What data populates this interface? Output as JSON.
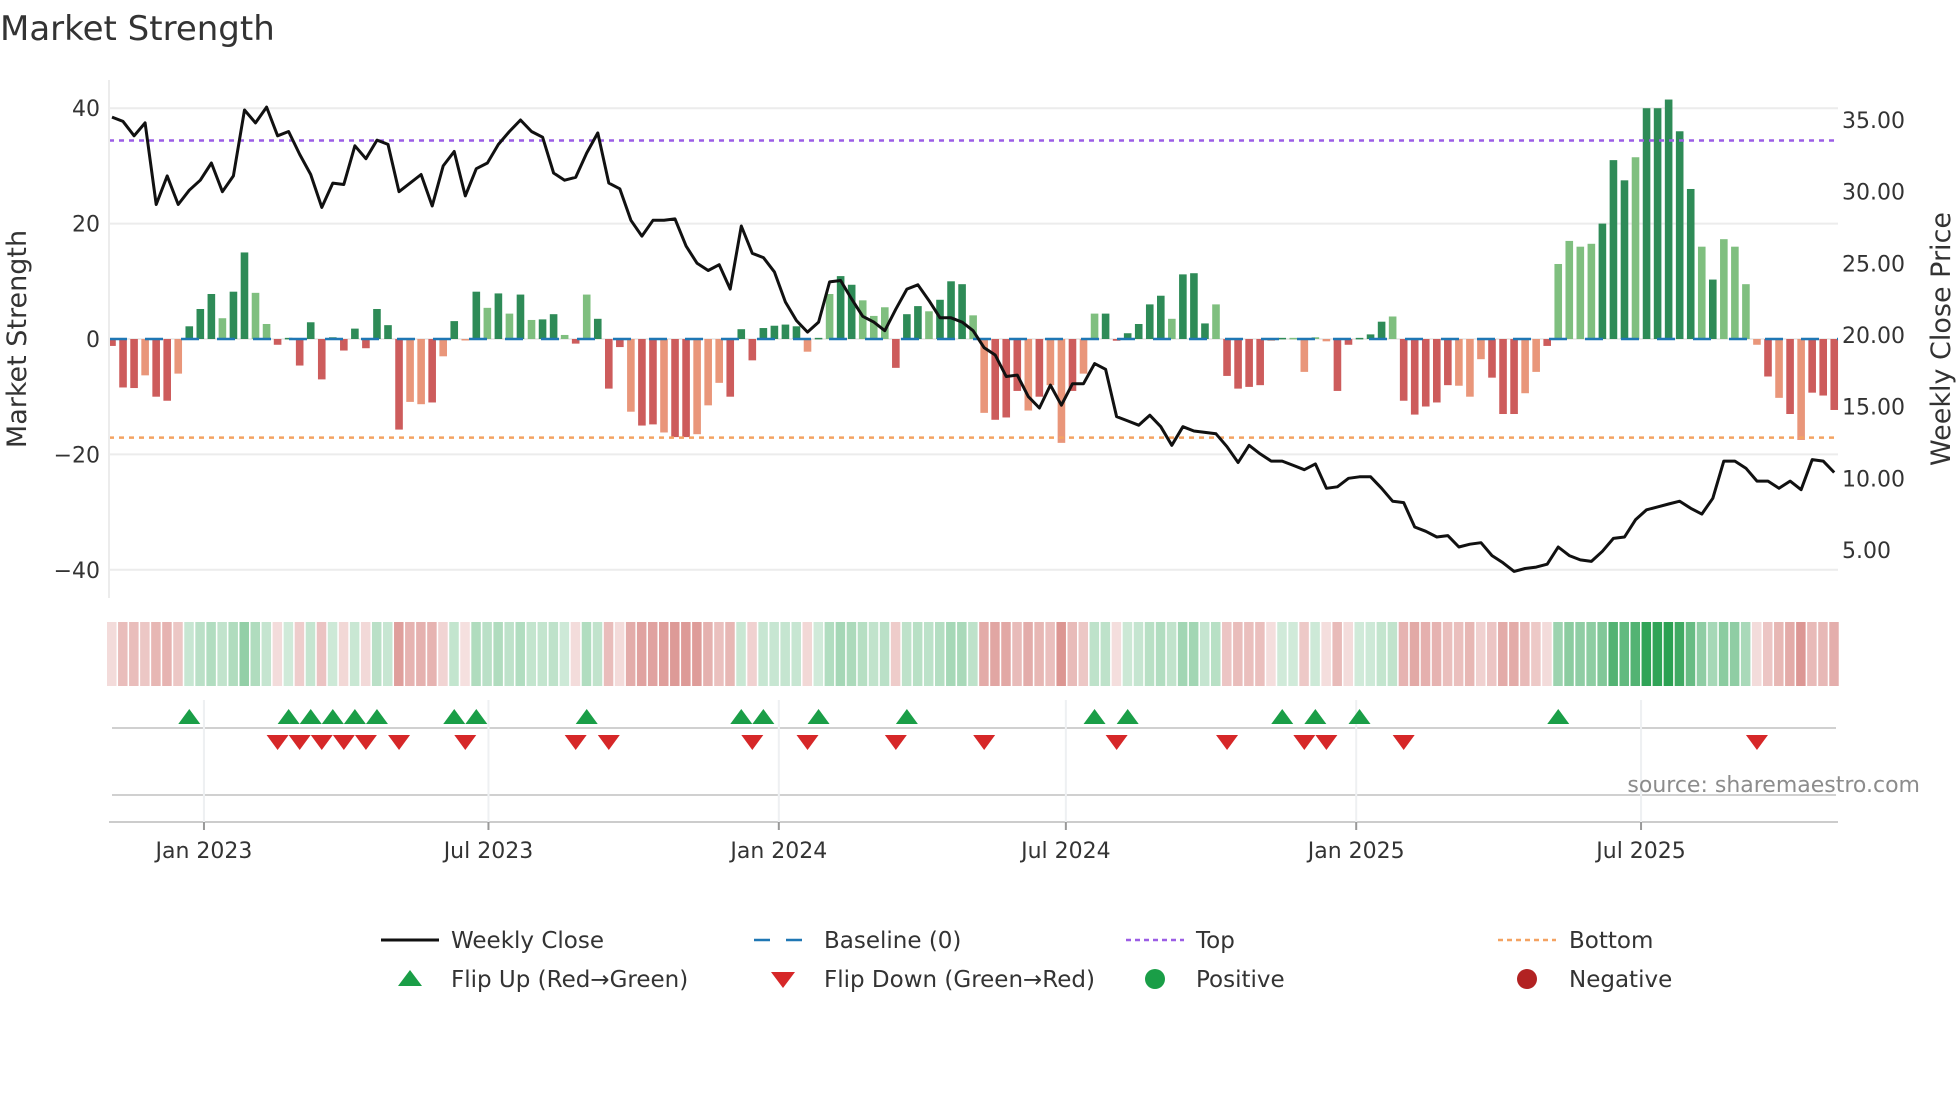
{
  "chart_data": {
    "type": "bar",
    "title": "Market Strength",
    "ylabel": "Market Strength",
    "y2label": "Weekly Close Price",
    "ylim": [
      -46,
      45
    ],
    "y2lim": [
      2.5,
      38.4
    ],
    "y_ticks": [
      "40",
      "20",
      "0",
      "−20",
      "−40"
    ],
    "y_tick_values": [
      40,
      20,
      0,
      -20,
      -40
    ],
    "y2_ticks": [
      "35.00",
      "30.00",
      "25.00",
      "20.00",
      "15.00",
      "10.00",
      "5.00"
    ],
    "y2_tick_values": [
      35,
      30,
      25,
      20,
      15,
      10,
      5
    ],
    "x_ticks": [
      {
        "label": "Jan 2023",
        "week": 9.33
      },
      {
        "label": "Jul 2023",
        "week": 35.1
      },
      {
        "label": "Jan 2024",
        "week": 61.4
      },
      {
        "label": "Jul 2024",
        "week": 87.4
      },
      {
        "label": "Jan 2025",
        "week": 113.7
      },
      {
        "label": "Jul 2025",
        "week": 139.5
      }
    ],
    "top_level": 34.4,
    "bottom_level": -17.1,
    "baseline": 0,
    "strength": [
      -1.2,
      -8.4,
      -8.5,
      -6.3,
      -10,
      -10.7,
      -6,
      2.2,
      5.2,
      7.8,
      3.6,
      8.2,
      15,
      8,
      2.6,
      -1,
      0.2,
      -4.6,
      2.9,
      -7,
      0.3,
      -2,
      1.8,
      -1.6,
      5.2,
      2.4,
      -15.7,
      -10.9,
      -11.3,
      -11,
      -3,
      3.1,
      -0.2,
      8.2,
      5.4,
      7.9,
      4.4,
      7.7,
      3.3,
      3.4,
      4.3,
      0.7,
      -0.8,
      7.7,
      3.5,
      -8.6,
      -1.4,
      -12.6,
      -15,
      -14.8,
      -16.2,
      -17,
      -17,
      -16.5,
      -11.5,
      -7.6,
      -10,
      1.7,
      -3.7,
      1.9,
      2.3,
      2.5,
      2.2,
      -2.2,
      0.2,
      7.8,
      10.9,
      9.4,
      6.7,
      4,
      5.5,
      -5,
      4.3,
      5.7,
      4.8,
      6.8,
      10,
      9.5,
      4.1,
      -12.8,
      -14,
      -13.6,
      -9,
      -12.4,
      -10,
      -8,
      -18,
      -9,
      -6,
      4.4,
      4.4,
      -0.3,
      1,
      2.6,
      6,
      7.5,
      3.5,
      11.2,
      11.4,
      2.7,
      6,
      -6.4,
      -8.6,
      -8.3,
      -8,
      -0.3,
      0.2,
      0.2,
      -5.7,
      0.3,
      -0.4,
      -9,
      -1,
      0.2,
      0.8,
      3,
      3.9,
      -10.7,
      -13.1,
      -11.7,
      -11,
      -8,
      -8.1,
      -10,
      -3.5,
      -6.7,
      -13,
      -13,
      -9.4,
      -5.7,
      -1.2,
      13,
      17,
      16,
      16.5,
      20,
      31,
      27.5,
      31.5,
      40,
      40,
      41.5,
      36,
      26,
      16,
      10.3,
      17.3,
      16,
      9.5,
      -1,
      -6.5,
      -10.2,
      -13,
      -17.5,
      -9.3,
      -9.8,
      -12.3
    ],
    "shade": "dddlddldddlddllddddddddddddlldldldldldlddldldddlddlddllldddddddldlddllldddldddlldddldlldllddddddldddlddddldlllldddddldddddllldddlldlllldddldddddldlllldldldddddldd",
    "weekly_close": [
      35.2,
      34.9,
      33.9,
      34.8,
      29.1,
      31.1,
      29.1,
      30.1,
      30.8,
      32.0,
      30.0,
      31.1,
      35.7,
      34.8,
      35.9,
      33.9,
      34.2,
      32.6,
      31.2,
      28.9,
      30.6,
      30.5,
      33.2,
      32.3,
      33.6,
      33.3,
      30.0,
      30.6,
      31.2,
      29.0,
      31.8,
      32.8,
      29.7,
      31.6,
      32.0,
      33.3,
      34.2,
      35.0,
      34.2,
      33.8,
      31.3,
      30.8,
      31.0,
      32.7,
      34.1,
      30.6,
      30.2,
      28.0,
      26.9,
      28.0,
      28.0,
      28.1,
      26.2,
      25.0,
      24.5,
      24.9,
      23.2,
      27.6,
      25.7,
      25.4,
      24.4,
      22.3,
      21.0,
      20.2,
      20.9,
      23.7,
      23.8,
      22.5,
      21.3,
      20.9,
      20.3,
      21.8,
      23.2,
      23.5,
      22.4,
      21.2,
      21.2,
      20.9,
      20.3,
      19.1,
      18.6,
      17.1,
      17.2,
      15.7,
      14.9,
      16.5,
      15.1,
      16.6,
      16.6,
      18.0,
      17.6,
      14.3,
      14.0,
      13.7,
      14.4,
      13.6,
      12.3,
      13.6,
      13.3,
      13.2,
      13.1,
      12.2,
      11.1,
      12.3,
      11.7,
      11.2,
      11.2,
      10.9,
      10.6,
      11.0,
      9.3,
      9.4,
      10.0,
      10.1,
      10.1,
      9.3,
      8.4,
      8.3,
      6.6,
      6.3,
      5.9,
      6.0,
      5.2,
      5.4,
      5.5,
      4.6,
      4.1,
      3.5,
      3.7,
      3.8,
      4.0,
      5.2,
      4.6,
      4.3,
      4.2,
      4.9,
      5.8,
      5.9,
      7.1,
      7.8,
      8.0,
      8.2,
      8.4,
      7.9,
      7.5,
      8.6,
      11.2,
      11.2,
      10.7,
      9.8,
      9.8,
      9.3,
      9.8,
      9.2,
      11.3,
      11.2,
      10.4
    ],
    "flip_up_weeks": [
      8,
      17,
      19,
      21,
      23,
      25,
      32,
      34,
      44,
      58,
      60,
      65,
      73,
      90,
      93,
      107,
      110,
      114,
      132
    ],
    "flip_down_weeks": [
      16,
      18,
      20,
      22,
      24,
      27,
      33,
      43,
      46,
      59,
      64,
      72,
      80,
      92,
      102,
      109,
      111,
      118,
      150
    ],
    "legend": {
      "position": "bottom",
      "items": [
        {
          "label": "Weekly Close",
          "kind": "line",
          "color": "#111111"
        },
        {
          "label": "Baseline (0)",
          "kind": "dash",
          "color": "#1f77b4"
        },
        {
          "label": "Top",
          "kind": "dot",
          "color": "#9b5de5"
        },
        {
          "label": "Bottom",
          "kind": "dot",
          "color": "#f4a261"
        },
        {
          "label": "Flip Up (Red→Green)",
          "kind": "up",
          "color": "#1a9e47"
        },
        {
          "label": "Flip Down (Green→Red)",
          "kind": "down",
          "color": "#d62728"
        },
        {
          "label": "Positive",
          "kind": "circle",
          "color": "#1a9e47"
        },
        {
          "label": "Negative",
          "kind": "circle",
          "color": "#b22222"
        }
      ]
    },
    "colors": {
      "pos_strong": "#2e8b57",
      "pos_weak": "#7fbf7f",
      "neg_strong": "#cd5c5c",
      "neg_weak": "#e9967a",
      "top": "#9b5de5",
      "bottom": "#f4a261",
      "baseline": "#1f77b4",
      "price": "#111111",
      "grid": "#ececec"
    }
  },
  "source": "source: sharemaestro.com"
}
